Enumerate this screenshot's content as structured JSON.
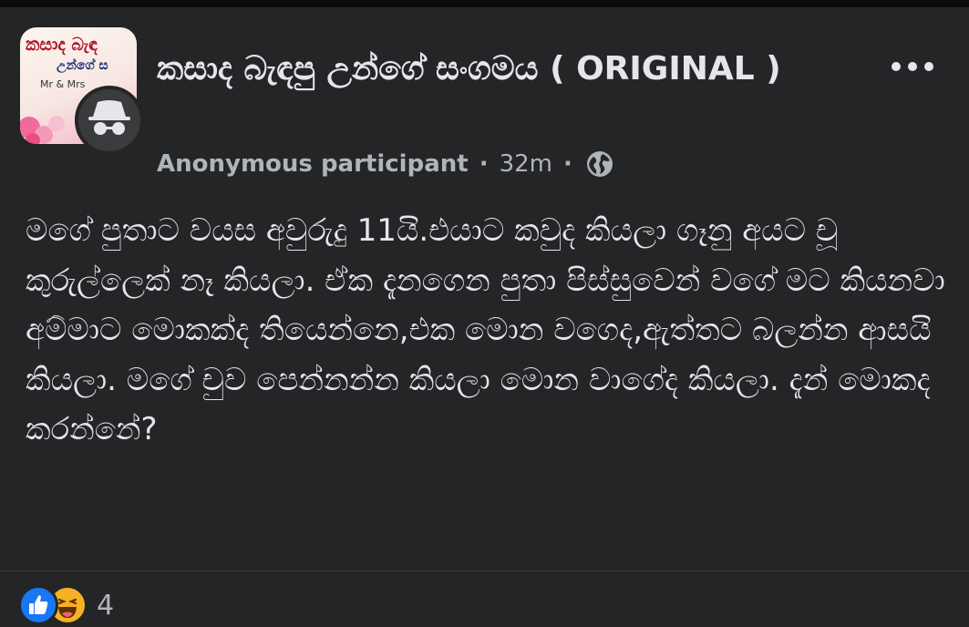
{
  "group": {
    "name": "කසාද බැඳපු උන්ගේ සංගමය ( ORIGINAL )",
    "thumbnail_text": {
      "line1": "කසාද බැඳ",
      "line2": "උන්ගේ ස",
      "line3": "Mr & Mrs"
    }
  },
  "post": {
    "author": "Anonymous participant",
    "time": "32m",
    "separator": "·",
    "privacy_icon": "globe-icon",
    "text": "මගේ පුතාට වයස අවුරුදු 11යි.එයාට කවුද කියලා ගෑනු අයට චූ කුරුල්ලෙක් නෑ කියලා. ඒක දැනගෙන පුතා පිස්සුවෙන් වගේ මට කියනවා අම්මාට මොකක්ද තියෙන්නෙ,එක මොන වගෙද,ඇත්තට බලන්න ආසයි කියලා. මගේ චුව පෙන්නන්න කියලා මොන වාගේද කියලා. දැන් මොකද කරන්නේ?"
  },
  "reactions": {
    "types": [
      "like-icon",
      "haha-icon"
    ],
    "count": "4"
  },
  "colors": {
    "background": "#242526",
    "text_primary": "#e4e6eb",
    "text_secondary": "#b0b3b8",
    "like_blue": "#1877f2",
    "haha_yellow": "#f7b125"
  }
}
